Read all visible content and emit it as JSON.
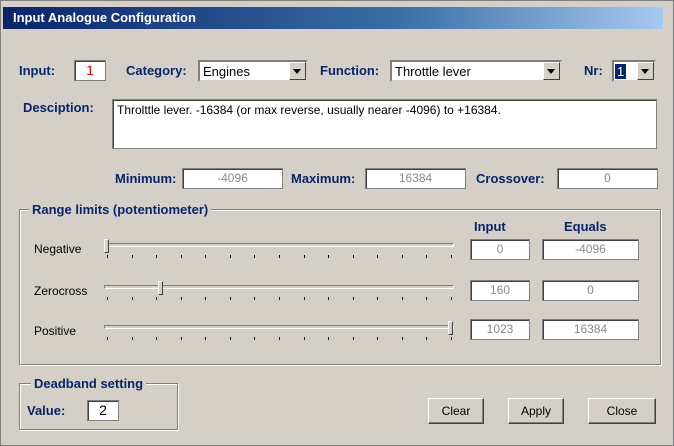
{
  "window": {
    "title": "Input Analogue Configuration"
  },
  "input": {
    "label": "Input:",
    "value": "1"
  },
  "category": {
    "label": "Category:",
    "value": "Engines"
  },
  "function": {
    "label": "Function:",
    "value": "Throttle lever"
  },
  "nr": {
    "label": "Nr:",
    "value": "1"
  },
  "description": {
    "label": "Desciption:",
    "value": "Throlttle lever. -16384 (or max reverse, usually nearer -4096) to +16384."
  },
  "minimum": {
    "label": "Minimum:",
    "value": "-4096"
  },
  "maximum": {
    "label": "Maximum:",
    "value": "16384"
  },
  "crossover": {
    "label": "Crossover:",
    "value": "0"
  },
  "range": {
    "title": "Range limits (potentiometer)",
    "col_input": "Input",
    "col_equals": "Equals",
    "rows": [
      {
        "label": "Negative",
        "input": "0",
        "equals": "-4096",
        "fraction": 0.0
      },
      {
        "label": "Zerocross",
        "input": "160",
        "equals": "0",
        "fraction": 0.156
      },
      {
        "label": "Positive",
        "input": "1023",
        "equals": "16384",
        "fraction": 1.0
      }
    ]
  },
  "deadband": {
    "title": "Deadband setting",
    "label": "Value:",
    "value": "2"
  },
  "buttons": {
    "clear": "Clear",
    "apply": "Apply",
    "close": "Close"
  }
}
